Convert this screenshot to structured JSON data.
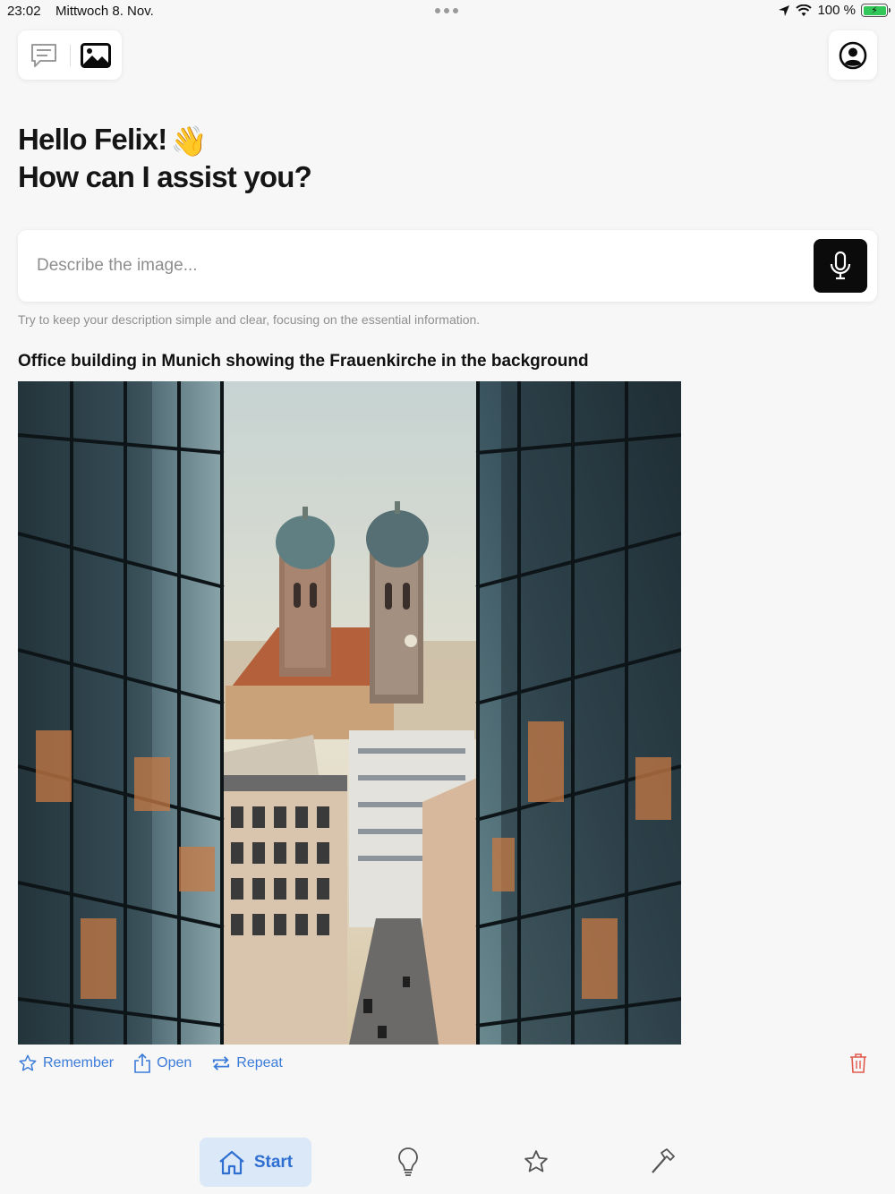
{
  "status_bar": {
    "time": "23:02",
    "date": "Mittwoch 8. Nov.",
    "battery": "100 %"
  },
  "header": {
    "mode_icons": [
      "chat-icon",
      "image-icon"
    ],
    "profile_icon": "profile-icon"
  },
  "greeting": {
    "line1": "Hello Felix!",
    "line2": "How can I assist you?",
    "emoji": "👋"
  },
  "prompt": {
    "placeholder": "Describe the image...",
    "value": "",
    "hint": "Try to keep your description simple and clear, focusing on the essential information."
  },
  "result": {
    "title": "Office building in Munich showing the Frauenkirche in the background",
    "actions": [
      {
        "label": "Remember",
        "icon": "star-icon"
      },
      {
        "label": "Open",
        "icon": "share-icon"
      },
      {
        "label": "Repeat",
        "icon": "repeat-icon"
      }
    ],
    "delete_icon": "trash-icon"
  },
  "nav": {
    "start_label": "Start",
    "items": [
      "home-icon",
      "lightbulb-icon",
      "star-icon",
      "hammer-icon"
    ]
  },
  "colors": {
    "accent": "#3b7bd9",
    "nav_active_bg": "#dbe8f7",
    "danger": "#e05a4e",
    "battery": "#32c759"
  }
}
